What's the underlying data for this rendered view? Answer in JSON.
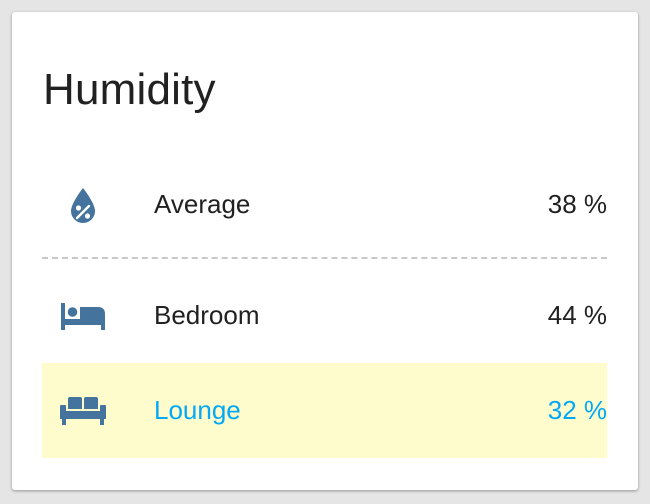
{
  "card": {
    "title": "Humidity",
    "rows": [
      {
        "icon": "water-percent-icon",
        "label": "Average",
        "value": "38 %",
        "highlighted": false
      },
      {
        "icon": "bed-icon",
        "label": "Bedroom",
        "value": "44 %",
        "highlighted": false
      },
      {
        "icon": "sofa-icon",
        "label": "Lounge",
        "value": "32 %",
        "highlighted": true
      }
    ]
  },
  "colors": {
    "icon": "#44739e",
    "highlight_background": "#fefccd",
    "highlight_text": "#03a9f4",
    "text": "#212121"
  }
}
